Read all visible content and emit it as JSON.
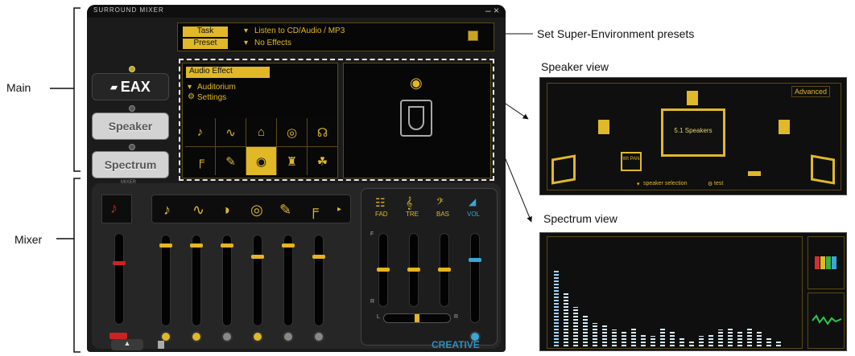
{
  "window": {
    "title": "SURROUND MIXER",
    "close_symbol": "– ×"
  },
  "top_panel": {
    "row1_tag": "Task",
    "row1_value": "Listen to CD/Audio / MP3",
    "row2_tag": "Preset",
    "row2_value": "No Effects"
  },
  "sidebar": {
    "eax": "EAX",
    "speaker": "Speaker",
    "spectrum": "Spectrum",
    "mixer_tab": "MIXER"
  },
  "effect_panel": {
    "header": "Audio Effect",
    "item1": "Auditorium",
    "item2": "Settings"
  },
  "eq": {
    "fad": "FAD",
    "tre": "TRE",
    "bas": "BAS",
    "vol": "VOL",
    "f_label": "F",
    "r_label": "R",
    "l_label": "L",
    "r2_label": "R"
  },
  "brand": "CREATIVE",
  "annotations": {
    "main": "Main",
    "mixer": "Mixer",
    "presets": "Set Super-Environment presets",
    "speaker_view": "Speaker view",
    "spectrum_view": "Spectrum view"
  },
  "speaker_view": {
    "advanced": "Advanced",
    "center_label": "5.1 Speakers",
    "selection": "speaker selection",
    "test": "test",
    "small_box": "Wt PAN"
  },
  "spectrum": {
    "bars": [
      0.74,
      0.52,
      0.38,
      0.3,
      0.22,
      0.2,
      0.16,
      0.14,
      0.18,
      0.12,
      0.1,
      0.18,
      0.14,
      0.08,
      0.06,
      0.1,
      0.12,
      0.16,
      0.18,
      0.14,
      0.18,
      0.14,
      0.08,
      0.06
    ]
  },
  "colors": {
    "accent": "#e0b828",
    "spectrum_bar": "#d8eefa",
    "red_mute": "#cc2222",
    "vol_blue": "#3aa6d8"
  }
}
